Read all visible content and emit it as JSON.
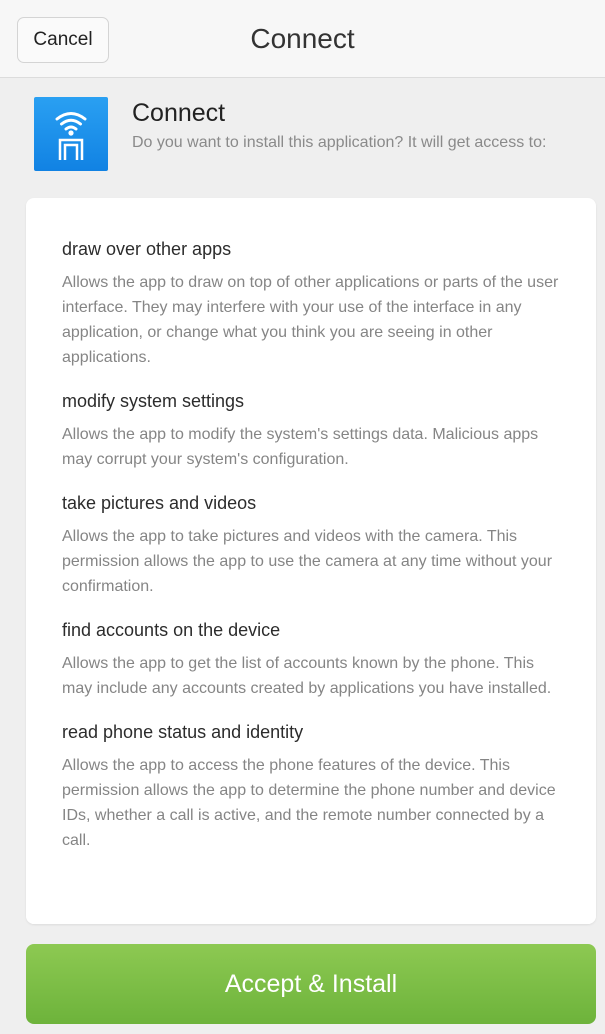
{
  "header": {
    "cancel_label": "Cancel",
    "title": "Connect"
  },
  "app": {
    "name": "Connect",
    "prompt": "Do you want to install this application? It will get access to:",
    "icon": "wifi-door-icon",
    "icon_color": "#1a8ee8"
  },
  "permissions": [
    {
      "title": "draw over other apps",
      "description": "Allows the app to draw on top of other applications or parts of the user interface. They may interfere with your use of the interface in any application, or change what you think you are seeing in other applications."
    },
    {
      "title": "modify system settings",
      "description": "Allows the app to modify the system's settings data. Malicious apps may corrupt your system's configuration."
    },
    {
      "title": "take pictures and videos",
      "description": "Allows the app to take pictures and videos with the camera. This permission allows the app to use the camera at any time without your confirmation."
    },
    {
      "title": "find accounts on the device",
      "description": "Allows the app to get the list of accounts known by the phone. This may include any accounts created by applications you have installed."
    },
    {
      "title": "read phone status and identity",
      "description": "Allows the app to access the phone features of the device. This permission allows the app to determine the phone number and device IDs, whether a call is active, and the remote number connected by a call."
    }
  ],
  "footer": {
    "accept_label": "Accept & Install",
    "accent_color": "#7abd45"
  }
}
